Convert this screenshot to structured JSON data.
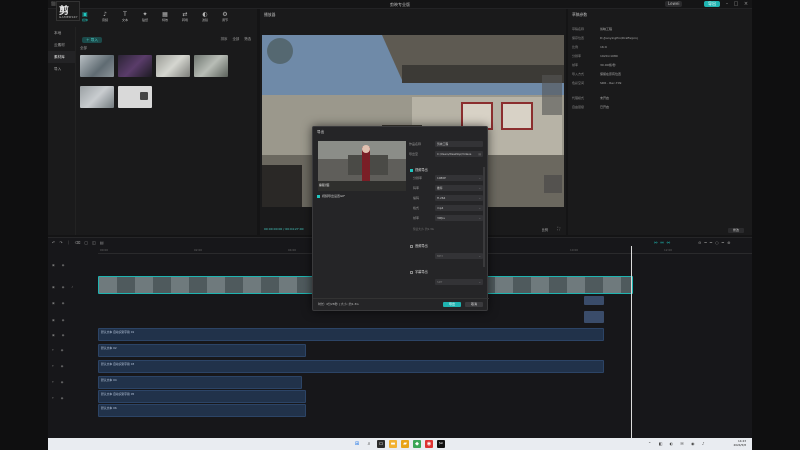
{
  "title": "剪映专业版",
  "watermark": {
    "big": "剪",
    "small": "GAMERSKY"
  },
  "titlebar": {
    "cloud": "Lewei",
    "export": "导出"
  },
  "toolbar": [
    {
      "icon": "▣",
      "label": "媒体"
    },
    {
      "icon": "♪",
      "label": "音频"
    },
    {
      "icon": "T",
      "label": "文本"
    },
    {
      "icon": "✦",
      "label": "贴纸"
    },
    {
      "icon": "▦",
      "label": "特效"
    },
    {
      "icon": "⇄",
      "label": "转场"
    },
    {
      "icon": "◐",
      "label": "滤镜"
    },
    {
      "icon": "⚙",
      "label": "调节"
    }
  ],
  "media_nav": [
    "本地",
    "云素材",
    "素材库",
    "导入"
  ],
  "media": {
    "import": "导入",
    "all": "全部",
    "sort": "排序",
    "view": "全部",
    "filter": "筛选"
  },
  "preview": {
    "title": "播放器",
    "timecode": "00:00:00:00 / 00:04:27:00",
    "ratio": "比例"
  },
  "properties": {
    "title": "草稿参数",
    "rows": [
      {
        "k": "草稿名称",
        "v": "剪映工程"
      },
      {
        "k": "保存位置",
        "v": "D:/JianyingPro/Drafts/proj"
      },
      {
        "k": "比例",
        "v": "16:9"
      },
      {
        "k": "分辨率",
        "v": "1920×1080"
      },
      {
        "k": "帧率",
        "v": "30.00帧/秒"
      },
      {
        "k": "导入方式",
        "v": "保留在原有位置"
      },
      {
        "k": "色彩空间",
        "v": "SDR - Rec.709"
      },
      {
        "k": "代理模式",
        "v": "未开启"
      },
      {
        "k": "自由层级",
        "v": "已开启"
      }
    ],
    "modify": "修改"
  },
  "timeline": {
    "ruler": [
      "00:00",
      "02:00",
      "04:00",
      "06:00",
      "08:00",
      "10:00",
      "12:00"
    ],
    "texts": [
      "默认文本 自动识别字幕 01",
      "默认文本 02",
      "默认文本 自动识别字幕 03",
      "默认文本 04",
      "默认文本 自动识别字幕 05",
      "默认文本 06"
    ]
  },
  "dialog": {
    "title": "导出",
    "edit_cover": "编辑封面",
    "gif": "视频导出设置GIF",
    "name_label": "作品名称",
    "name": "剪映工程",
    "path_label": "导出至",
    "path": "C:/Users/Desktop/Videos",
    "video_check": "视频导出",
    "rows": [
      {
        "k": "分辨率",
        "v": "1080P"
      },
      {
        "k": "码率",
        "v": "推荐"
      },
      {
        "k": "编码",
        "v": "H.264"
      },
      {
        "k": "格式",
        "v": "mp4"
      },
      {
        "k": "帧率",
        "v": "30fps"
      }
    ],
    "size": "预估大小: 约1.3G",
    "audio_check": "音频导出",
    "audio_format": "MP3",
    "subtitle_check": "字幕导出",
    "subtitle_format": "SRT",
    "footer": "时长: 4分28秒 | 大小: 约1.3G",
    "export": "导出",
    "cancel": "取消"
  },
  "taskbar": {
    "time": "14:23",
    "date": "2024/5/8"
  }
}
